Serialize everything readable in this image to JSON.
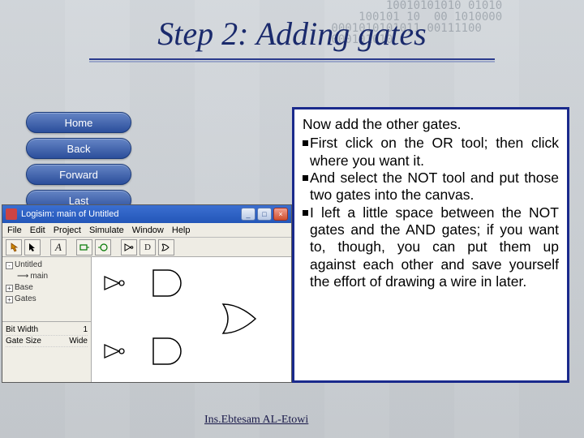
{
  "slide": {
    "title": "Step 2: Adding gates",
    "bg_digits": "         10010101010 01010\n     100101 10  00 1010000\n 0001010101011 00111100\n 000101010"
  },
  "nav": {
    "items": [
      {
        "label": "Home"
      },
      {
        "label": "Back"
      },
      {
        "label": "Forward"
      },
      {
        "label": "Last"
      }
    ]
  },
  "app": {
    "title": "Logisim: main of Untitled",
    "menus": [
      "File",
      "Edit",
      "Project",
      "Simulate",
      "Window",
      "Help"
    ],
    "tree": {
      "root": "Untitled",
      "items": [
        "main",
        "Base",
        "Gates"
      ]
    },
    "props": [
      {
        "k": "Bit Width",
        "v": "1"
      },
      {
        "k": "Gate Size",
        "v": "Wide"
      }
    ]
  },
  "info": {
    "intro": "Now add the other gates.",
    "bullets": [
      "First click on the OR tool; then click where you want it.",
      "And select the NOT tool and put those two gates into the canvas.",
      "I left a little space between the NOT gates and the AND gates; if you want to, though, you can put them up against each other and save yourself the effort of drawing a wire in later."
    ]
  },
  "footer": "Ins.Ebtesam AL-Etowi"
}
